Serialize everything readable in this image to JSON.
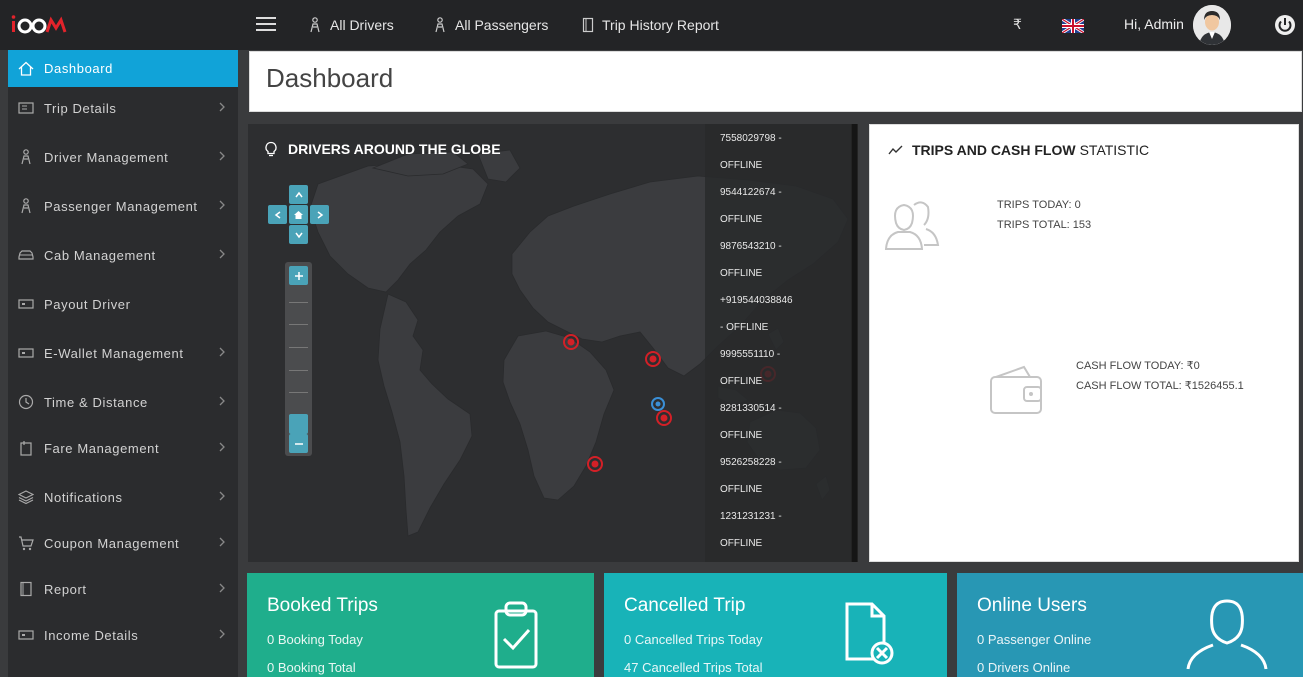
{
  "topbar": {
    "nav": [
      {
        "label": "All Drivers",
        "icon": "driver-icon"
      },
      {
        "label": "All Passengers",
        "icon": "passenger-icon"
      },
      {
        "label": "Trip History Report",
        "icon": "document-icon"
      }
    ],
    "currency": "₹",
    "greeting": "Hi, Admin",
    "brand_accent": "#e2232b"
  },
  "sidebar": {
    "items": [
      {
        "label": "Dashboard",
        "icon": "home-icon",
        "active": true
      },
      {
        "label": "Trip Details",
        "icon": "trip-icon"
      },
      {
        "label": "Driver Management",
        "icon": "driver-icon"
      },
      {
        "label": "Passenger Management",
        "icon": "passenger-icon"
      },
      {
        "label": "Cab Management",
        "icon": "car-icon"
      },
      {
        "label": "Payout Driver",
        "icon": "payout-icon"
      },
      {
        "label": "E-Wallet Management",
        "icon": "wallet-icon"
      },
      {
        "label": "Time & Distance",
        "icon": "clock-icon"
      },
      {
        "label": "Fare Management",
        "icon": "fare-icon"
      },
      {
        "label": "Notifications",
        "icon": "layers-icon"
      },
      {
        "label": "Coupon Management",
        "icon": "cart-icon"
      },
      {
        "label": "Report",
        "icon": "report-icon"
      },
      {
        "label": "Income Details",
        "icon": "income-icon"
      }
    ],
    "active_color": "#11a3d8"
  },
  "page": {
    "title": "Dashboard"
  },
  "map": {
    "title": "DRIVERS AROUND THE GLOBE",
    "drivers": [
      {
        "phone": "7558029798 -",
        "status": "OFFLINE"
      },
      {
        "phone": "9544122674 -",
        "status": "OFFLINE"
      },
      {
        "phone": "9876543210 -",
        "status": "OFFLINE"
      },
      {
        "phone": "+919544038846",
        "status": "- OFFLINE"
      },
      {
        "phone": "9995551110 -",
        "status": "OFFLINE"
      },
      {
        "phone": "8281330514 -",
        "status": "OFFLINE"
      },
      {
        "phone": "9526258228 -",
        "status": "OFFLINE"
      },
      {
        "phone": "1231231231 -",
        "status": "OFFLINE"
      }
    ]
  },
  "stats": {
    "title_bold": "TRIPS AND CASH FLOW",
    "title_rest": "STATISTIC",
    "trips_today": "TRIPS TODAY: 0",
    "trips_total": "TRIPS TOTAL: 153",
    "cash_today": "CASH FLOW TODAY: ₹0",
    "cash_total": "CASH FLOW TOTAL: ₹1526455.1"
  },
  "cards": {
    "booked": {
      "title": "Booked Trips",
      "line1": "0 Booking Today",
      "line2": "0 Booking Total",
      "color": "#1fae8c"
    },
    "cancelled": {
      "title": "Cancelled Trip",
      "line1": "0 Cancelled Trips Today",
      "line2": "47 Cancelled Trips Total",
      "color": "#18b3b8"
    },
    "online": {
      "title": "Online Users",
      "line1": "0 Passenger Online",
      "line2": "0 Drivers Online",
      "color": "#2897b4"
    }
  }
}
